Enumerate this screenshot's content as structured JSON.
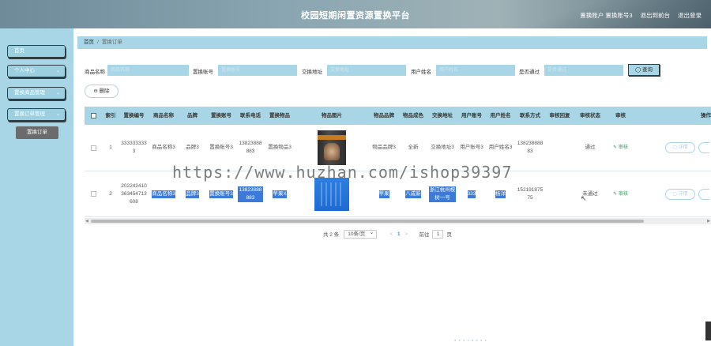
{
  "header": {
    "title": "校园短期闲置资源置换平台",
    "user_label": "置换账户 置换账号3",
    "back_label": "退出到前台",
    "logout_label": "退出登录"
  },
  "sidebar": {
    "items": [
      {
        "label": "首页"
      },
      {
        "label": "个人中心",
        "chevron": "⌄"
      },
      {
        "label": "置换商品管理",
        "chevron": "⌄"
      },
      {
        "label": "置换订单管理",
        "chevron": "⌄"
      }
    ],
    "active_sub": "置换订单"
  },
  "breadcrumb": {
    "home": "首页",
    "sep": "/",
    "current": "置换订单"
  },
  "search": {
    "labels": [
      "商品名称",
      "置换账号",
      "交换地址",
      "用户姓名",
      "是否通过"
    ],
    "placeholders": [
      "商品名称",
      "置换账号",
      "交换地址",
      "用户姓名",
      "是否通过"
    ],
    "query_label": "◯ 查询"
  },
  "toolbar": {
    "delete_label": "⊖ 删除"
  },
  "table": {
    "headers": [
      "索引",
      "置换编号",
      "商品名称",
      "品牌",
      "置换账号",
      "联系电话",
      "置换物品",
      "物品图片",
      "物品品牌",
      "物品成色",
      "交换地址",
      "用户账号",
      "用户姓名",
      "联系方式",
      "审核回复",
      "审核状态",
      "审核",
      "操作"
    ],
    "rows": [
      {
        "index": "1",
        "code": "3333333333",
        "name": "商品名称3",
        "brand": "品牌3",
        "account": "置换账号3",
        "phone": "13823888883",
        "item": "置换物品3",
        "item_brand": "物品品牌3",
        "condition": "全新",
        "address": "交换地址3",
        "user_account": "用户账号3",
        "user_name": "用户姓名3",
        "contact": "13823888883",
        "reply": "",
        "status": "通过",
        "audit": "✎ 审核",
        "detail": "▢ 详情"
      },
      {
        "index": "2",
        "code": "202242410363454713608",
        "name": "商品名称3",
        "brand": "品牌3",
        "account": "置换账号3",
        "phone": "13823888883",
        "item": "苹果X",
        "item_brand": "苹果",
        "condition": "八成新",
        "address": "浙江杭州桉树一号",
        "user_account": "333",
        "user_name": "杨洋",
        "contact": "15219187575",
        "reply": "",
        "status": "未通过",
        "audit": "✎ 审核",
        "detail": "▢ 详情"
      }
    ]
  },
  "pager": {
    "total": "共 2 条",
    "page_size": "10条/页",
    "prev": "<",
    "current": "1",
    "next": ">",
    "goto_label": "前往",
    "goto_value": "1",
    "page_unit": "页"
  },
  "watermark": "https://www.huzhan.com/ishop39397"
}
